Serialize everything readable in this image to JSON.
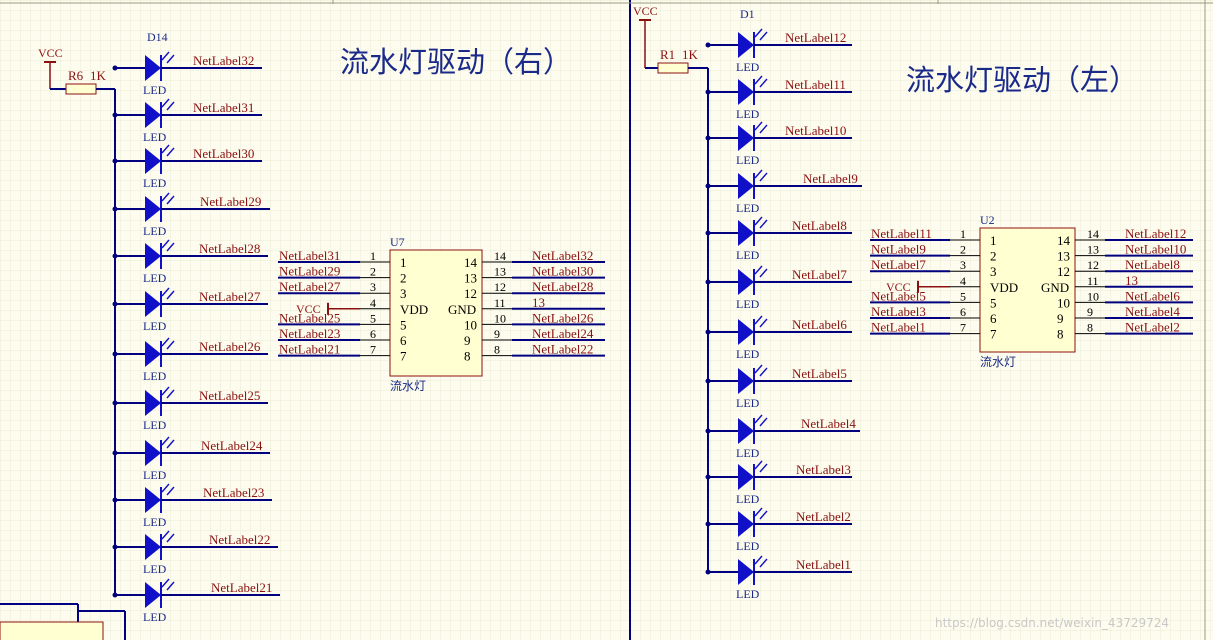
{
  "right": {
    "title": "流水灯驱动（右）",
    "vcc": "VCC",
    "resistor": {
      "ref": "R6",
      "value": "1K"
    },
    "first_led_ref": "D14",
    "led_label": "LED",
    "led_nets": [
      "NetLabel32",
      "NetLabel31",
      "NetLabel30",
      "NetLabel29",
      "NetLabel28",
      "NetLabel27",
      "NetLabel26",
      "NetLabel25",
      "NetLabel24",
      "NetLabel23",
      "NetLabel22",
      "NetLabel21"
    ],
    "ic": {
      "ref": "U7",
      "name": "流水灯",
      "left_pins": [
        {
          "num": "1",
          "name": "1",
          "net": "NetLabel31"
        },
        {
          "num": "2",
          "name": "2",
          "net": "NetLabel29"
        },
        {
          "num": "3",
          "name": "3",
          "net": "NetLabel27"
        },
        {
          "num": "4",
          "name": "VDD",
          "net": "VCC"
        },
        {
          "num": "5",
          "name": "5",
          "net": "NetLabel25"
        },
        {
          "num": "6",
          "name": "6",
          "net": "NetLabel23"
        },
        {
          "num": "7",
          "name": "7",
          "net": "NetLabel21"
        }
      ],
      "right_pins": [
        {
          "num": "14",
          "name": "14",
          "net": "NetLabel32"
        },
        {
          "num": "13",
          "name": "13",
          "net": "NetLabel30"
        },
        {
          "num": "12",
          "name": "12",
          "net": "NetLabel28"
        },
        {
          "num": "11",
          "name": "GND",
          "net": "13"
        },
        {
          "num": "10",
          "name": "10",
          "net": "NetLabel26"
        },
        {
          "num": "9",
          "name": "9",
          "net": "NetLabel24"
        },
        {
          "num": "8",
          "name": "8",
          "net": "NetLabel22"
        }
      ]
    }
  },
  "left": {
    "title": "流水灯驱动（左）",
    "vcc": "VCC",
    "resistor": {
      "ref": "R1",
      "value": "1K"
    },
    "first_led_ref": "D1",
    "led_label": "LED",
    "led_nets": [
      "NetLabel12",
      "NetLabel11",
      "NetLabel10",
      "NetLabel9",
      "NetLabel8",
      "NetLabel7",
      "NetLabel6",
      "NetLabel5",
      "NetLabel4",
      "NetLabel3",
      "NetLabel2",
      "NetLabel1"
    ],
    "ic": {
      "ref": "U2",
      "name": "流水灯",
      "left_pins": [
        {
          "num": "1",
          "name": "1",
          "net": "NetLabel11"
        },
        {
          "num": "2",
          "name": "2",
          "net": "NetLabel9"
        },
        {
          "num": "3",
          "name": "3",
          "net": "NetLabel7"
        },
        {
          "num": "4",
          "name": "VDD",
          "net": "VCC"
        },
        {
          "num": "5",
          "name": "5",
          "net": "NetLabel5"
        },
        {
          "num": "6",
          "name": "6",
          "net": "NetLabel3"
        },
        {
          "num": "7",
          "name": "7",
          "net": "NetLabel1"
        }
      ],
      "right_pins": [
        {
          "num": "14",
          "name": "14",
          "net": "NetLabel12"
        },
        {
          "num": "13",
          "name": "13",
          "net": "NetLabel10"
        },
        {
          "num": "12",
          "name": "12",
          "net": "NetLabel8"
        },
        {
          "num": "11",
          "name": "GND",
          "net": "13"
        },
        {
          "num": "10",
          "name": "10",
          "net": "NetLabel6"
        },
        {
          "num": "9",
          "name": "9",
          "net": "NetLabel4"
        },
        {
          "num": "8",
          "name": "8",
          "net": "NetLabel2"
        }
      ]
    }
  },
  "watermark": "https://blog.csdn.net/weixin_43729724",
  "colors": {
    "wire": "#000080",
    "led": "#1010c8",
    "net": "#8b1010",
    "ic_fill": "#ffffd2",
    "ic_border": "#8b1010",
    "sheet_border": "#000080"
  }
}
